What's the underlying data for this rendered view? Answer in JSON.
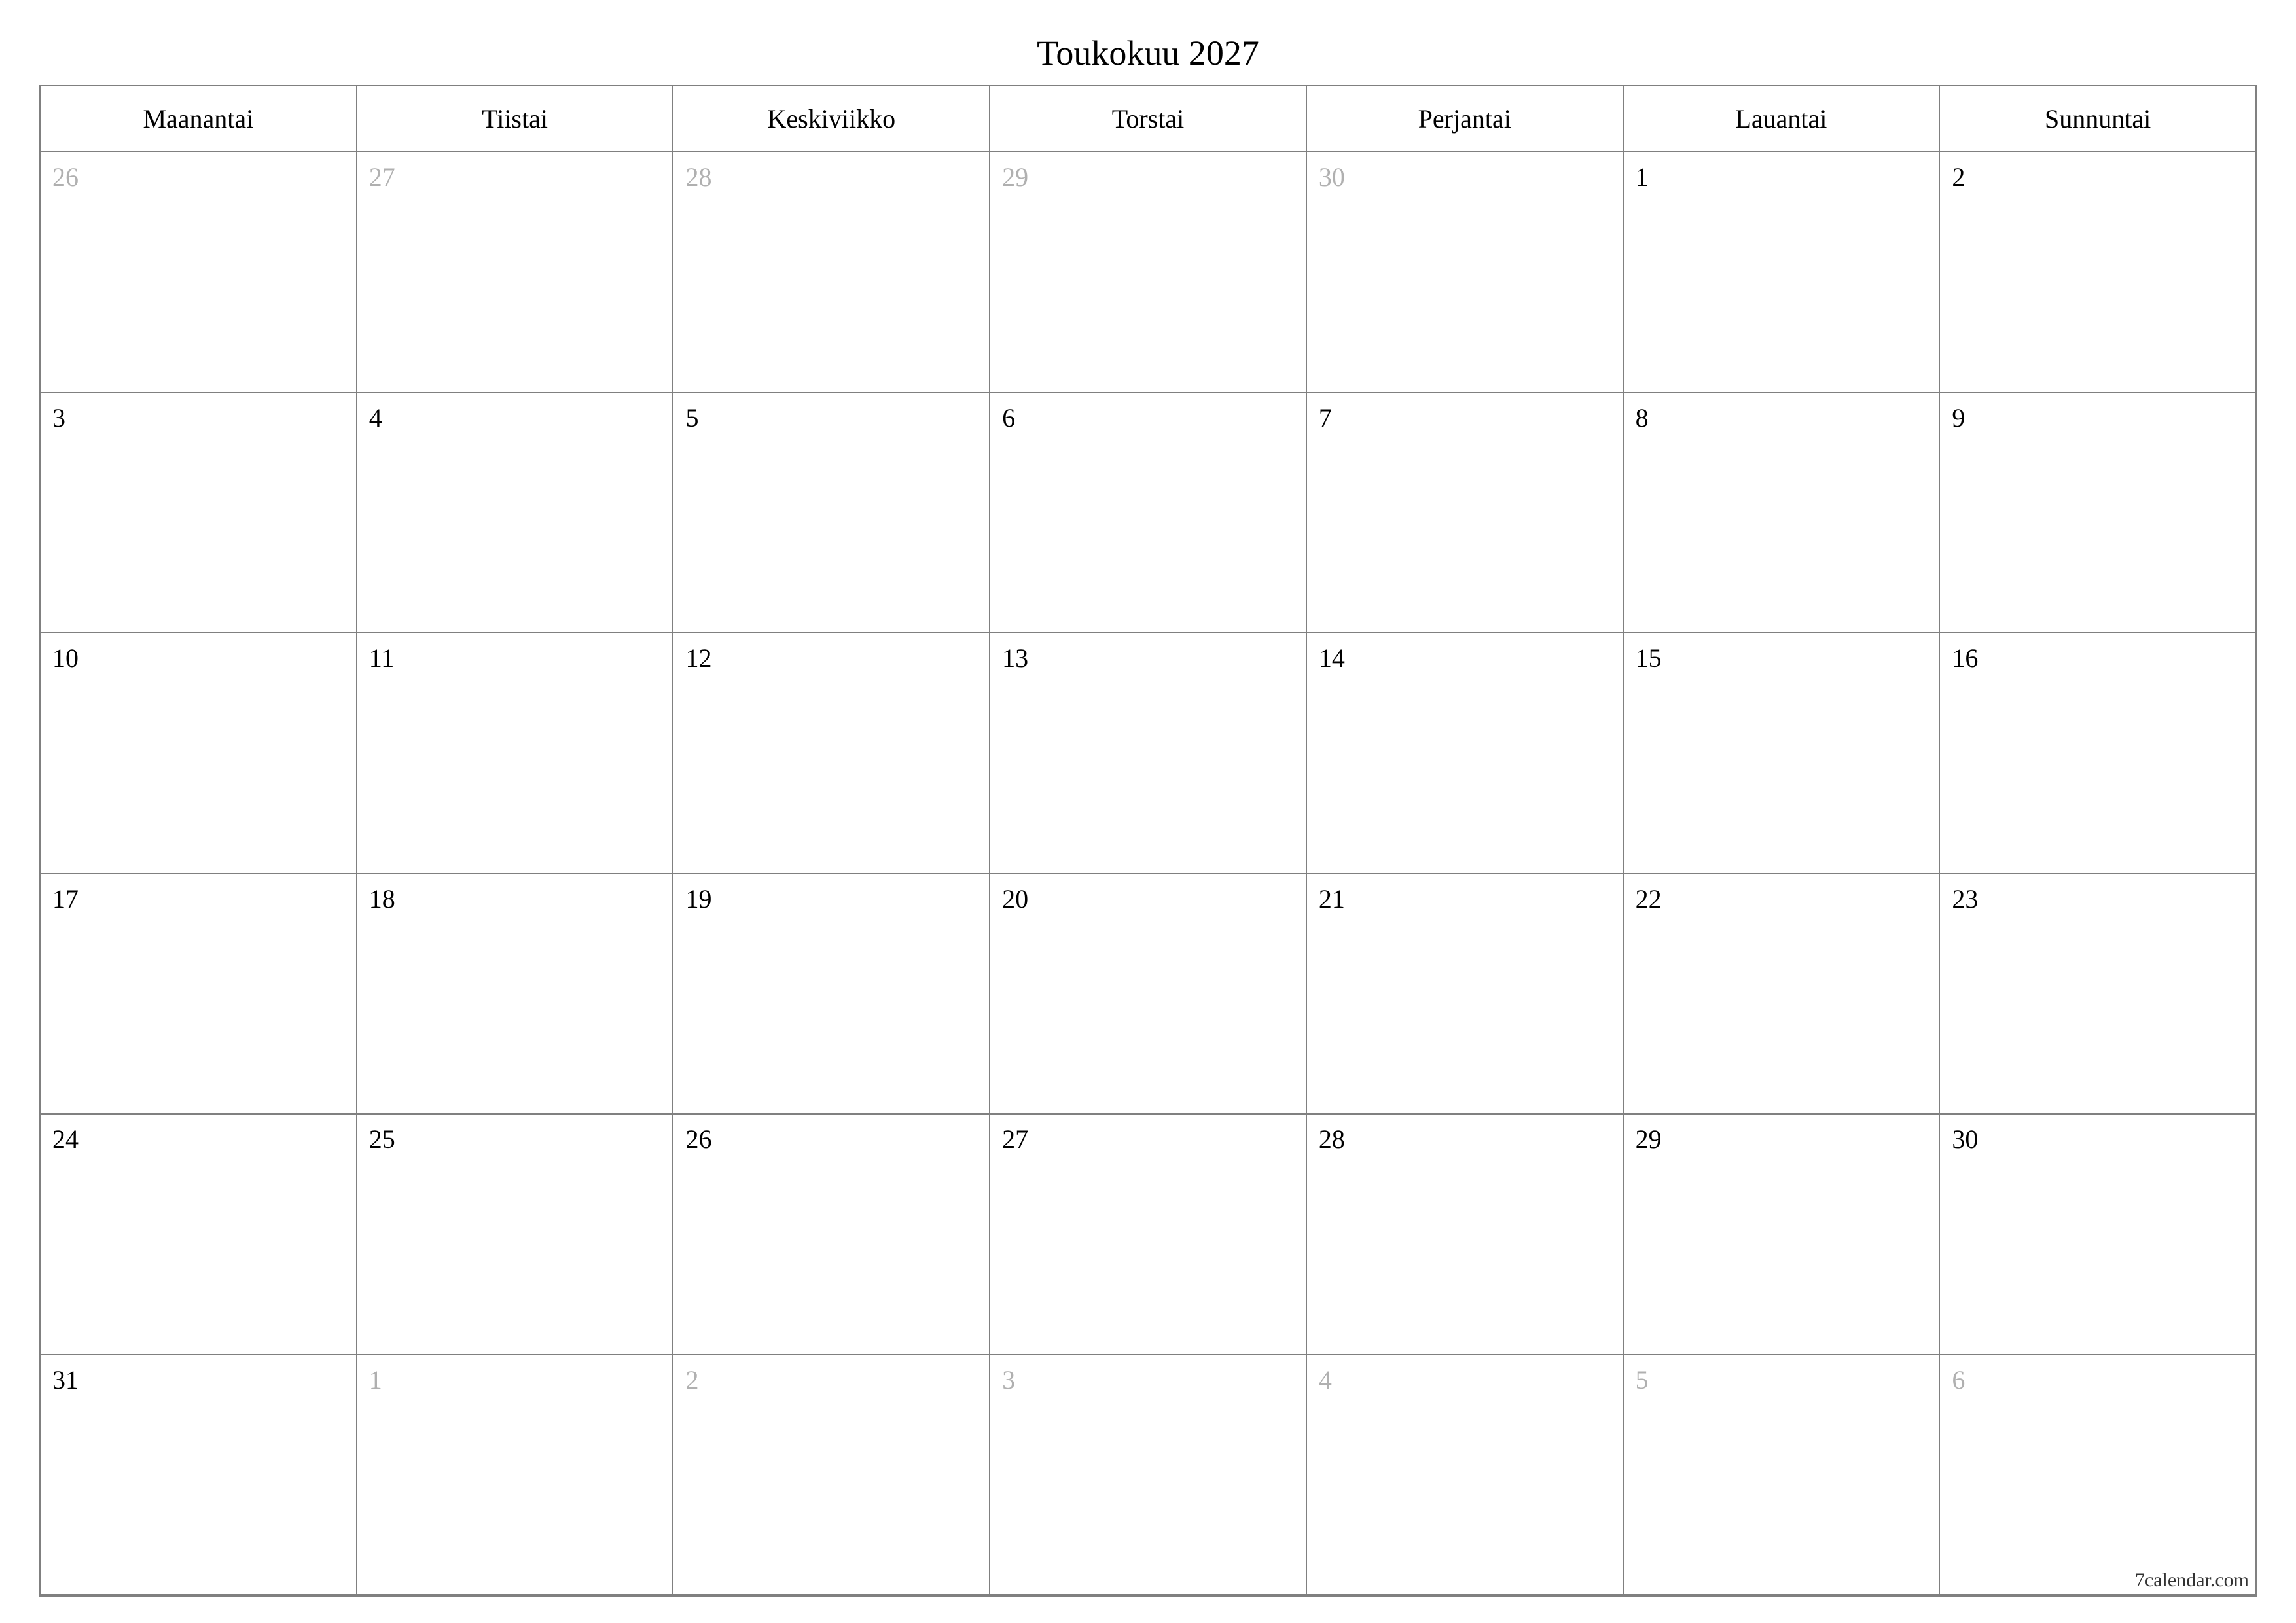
{
  "title": "Toukokuu 2027",
  "footer": "7calendar.com",
  "weekdays": [
    "Maanantai",
    "Tiistai",
    "Keskiviikko",
    "Torstai",
    "Perjantai",
    "Lauantai",
    "Sunnuntai"
  ],
  "weeks": [
    [
      {
        "day": "26",
        "otherMonth": true
      },
      {
        "day": "27",
        "otherMonth": true
      },
      {
        "day": "28",
        "otherMonth": true
      },
      {
        "day": "29",
        "otherMonth": true
      },
      {
        "day": "30",
        "otherMonth": true
      },
      {
        "day": "1",
        "otherMonth": false
      },
      {
        "day": "2",
        "otherMonth": false
      }
    ],
    [
      {
        "day": "3",
        "otherMonth": false
      },
      {
        "day": "4",
        "otherMonth": false
      },
      {
        "day": "5",
        "otherMonth": false
      },
      {
        "day": "6",
        "otherMonth": false
      },
      {
        "day": "7",
        "otherMonth": false
      },
      {
        "day": "8",
        "otherMonth": false
      },
      {
        "day": "9",
        "otherMonth": false
      }
    ],
    [
      {
        "day": "10",
        "otherMonth": false
      },
      {
        "day": "11",
        "otherMonth": false
      },
      {
        "day": "12",
        "otherMonth": false
      },
      {
        "day": "13",
        "otherMonth": false
      },
      {
        "day": "14",
        "otherMonth": false
      },
      {
        "day": "15",
        "otherMonth": false
      },
      {
        "day": "16",
        "otherMonth": false
      }
    ],
    [
      {
        "day": "17",
        "otherMonth": false
      },
      {
        "day": "18",
        "otherMonth": false
      },
      {
        "day": "19",
        "otherMonth": false
      },
      {
        "day": "20",
        "otherMonth": false
      },
      {
        "day": "21",
        "otherMonth": false
      },
      {
        "day": "22",
        "otherMonth": false
      },
      {
        "day": "23",
        "otherMonth": false
      }
    ],
    [
      {
        "day": "24",
        "otherMonth": false
      },
      {
        "day": "25",
        "otherMonth": false
      },
      {
        "day": "26",
        "otherMonth": false
      },
      {
        "day": "27",
        "otherMonth": false
      },
      {
        "day": "28",
        "otherMonth": false
      },
      {
        "day": "29",
        "otherMonth": false
      },
      {
        "day": "30",
        "otherMonth": false
      }
    ],
    [
      {
        "day": "31",
        "otherMonth": false
      },
      {
        "day": "1",
        "otherMonth": true
      },
      {
        "day": "2",
        "otherMonth": true
      },
      {
        "day": "3",
        "otherMonth": true
      },
      {
        "day": "4",
        "otherMonth": true
      },
      {
        "day": "5",
        "otherMonth": true
      },
      {
        "day": "6",
        "otherMonth": true
      }
    ]
  ]
}
